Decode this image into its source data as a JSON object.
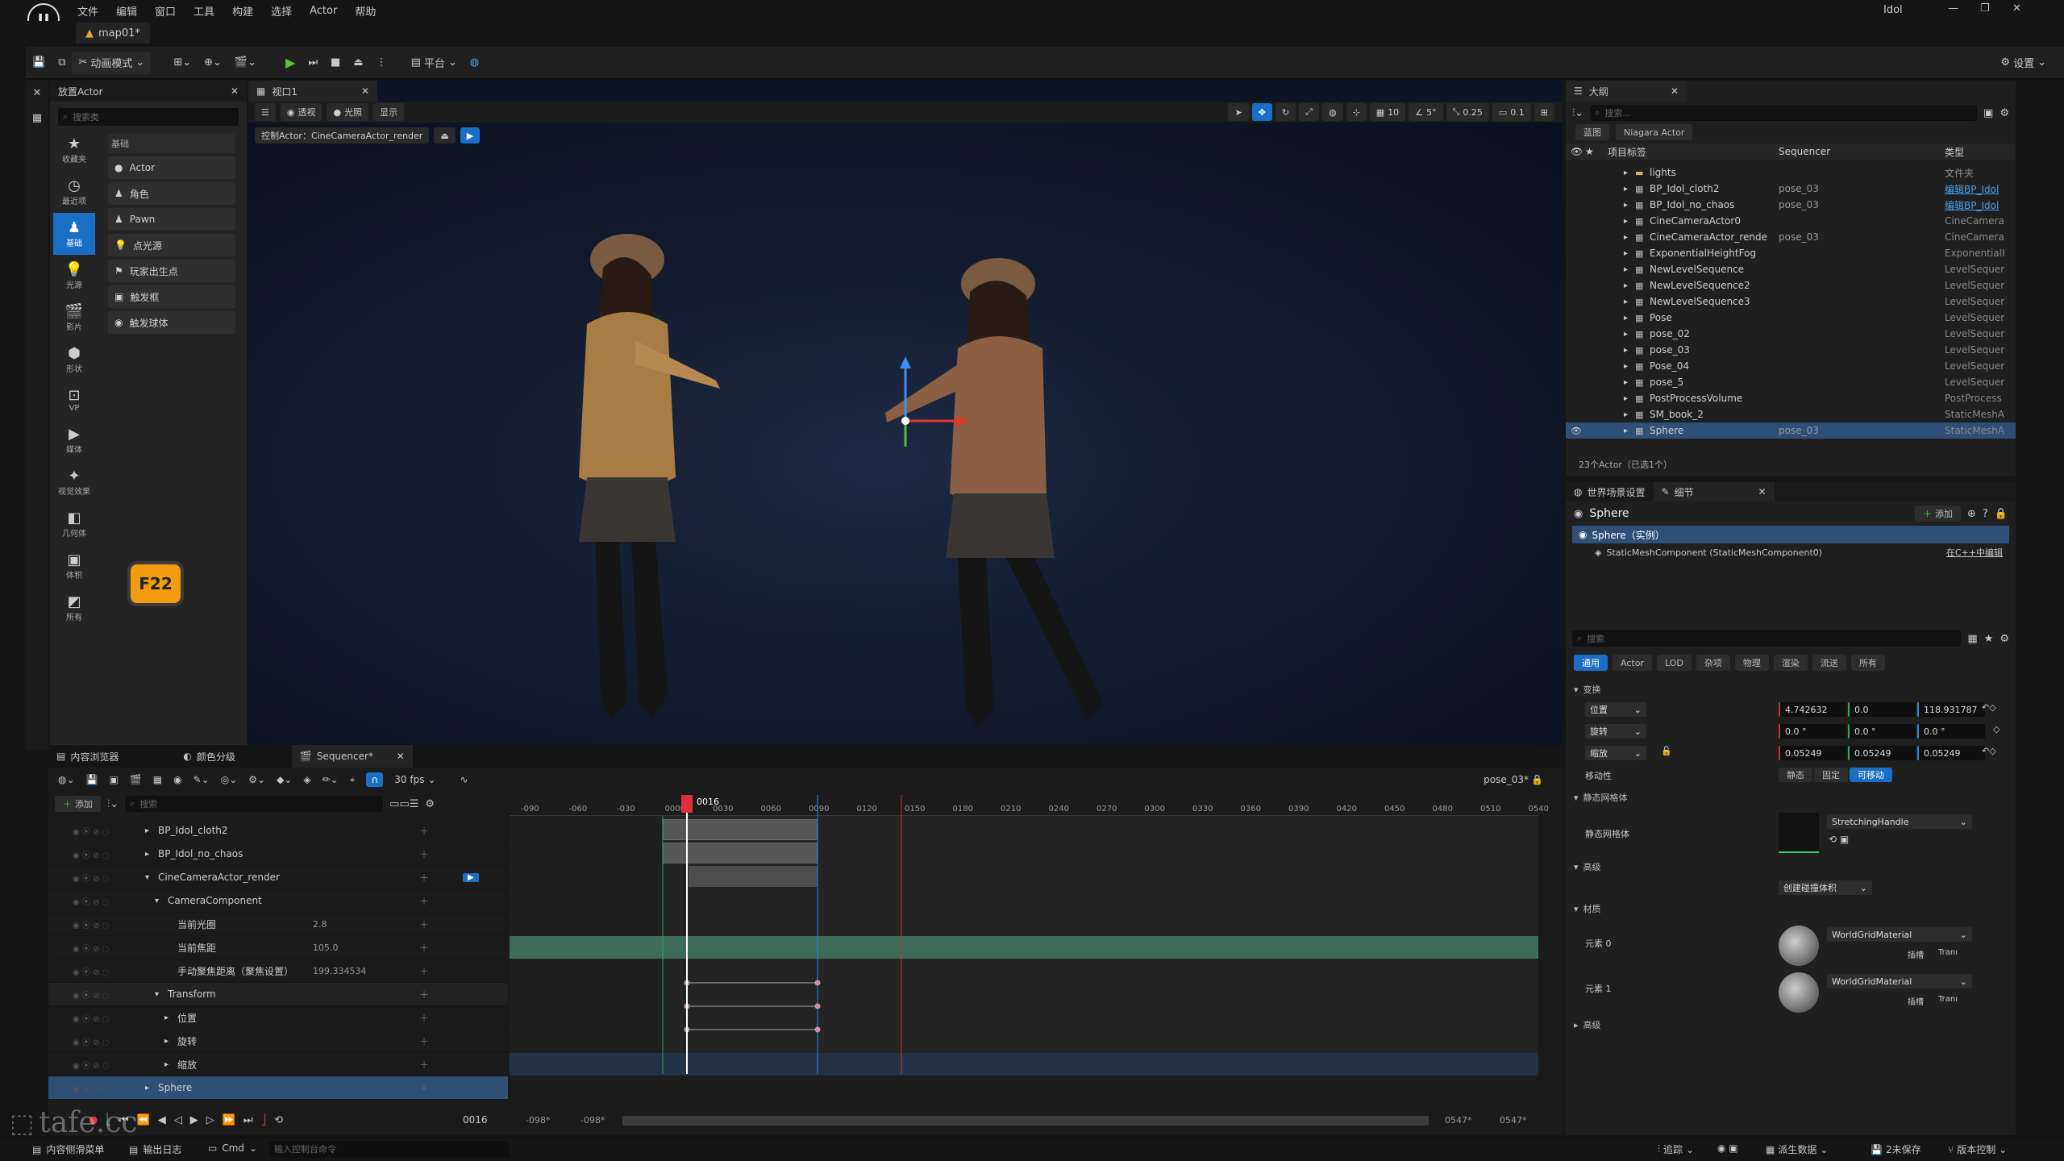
{
  "app": {
    "title": "Idol",
    "map_tab": "map01*",
    "menus": [
      "文件",
      "编辑",
      "窗口",
      "工具",
      "构建",
      "选择",
      "Actor",
      "帮助"
    ],
    "window_controls": [
      "—",
      "❐",
      "✕"
    ]
  },
  "toolbar": {
    "mode_label": "动画模式",
    "platform_label": "平台",
    "settings_label": "设置"
  },
  "left_strip": {
    "labels": [
      "收藏夹",
      "最近项",
      "基础",
      "光源",
      "影片",
      "形状",
      "VP",
      "媒体",
      "视觉效果",
      "几何体",
      "体积",
      "所有"
    ]
  },
  "place_actor": {
    "tab": "放置Actor",
    "search_placeholder": "搜索类",
    "category": "基础",
    "items": [
      "Actor",
      "角色",
      "Pawn",
      "点光源",
      "玩家出生点",
      "触发框",
      "触发球体"
    ]
  },
  "f22_badge": "F22",
  "viewport": {
    "tab": "视口1",
    "buttons": [
      "透视",
      "光照",
      "显示"
    ],
    "pilot_label": "控制Actor：CineCameraActor_render",
    "grid_value": "10",
    "angle_value": "5°",
    "scale_value": "0.25",
    "camera_speed": "0.1"
  },
  "outliner": {
    "tab": "大纲",
    "search_placeholder": "搜索...",
    "filters": [
      "蓝图",
      "Niagara Actor"
    ],
    "col_label": "项目标签",
    "col_seq": "Sequencer",
    "col_type": "类型",
    "rows": [
      {
        "name": "lights",
        "seq": "",
        "type": "文件夹"
      },
      {
        "name": "BP_Idol_cloth2",
        "seq": "pose_03",
        "type": "编辑BP_Idol"
      },
      {
        "name": "BP_Idol_no_chaos",
        "seq": "pose_03",
        "type": "编辑BP_Idol"
      },
      {
        "name": "CineCameraActor0",
        "seq": "",
        "type": "CineCamera"
      },
      {
        "name": "CineCameraActor_rende",
        "seq": "pose_03",
        "type": "CineCamera"
      },
      {
        "name": "ExponentialHeightFog",
        "seq": "",
        "type": "ExponentialH"
      },
      {
        "name": "NewLevelSequence",
        "seq": "",
        "type": "LevelSequer"
      },
      {
        "name": "NewLevelSequence2",
        "seq": "",
        "type": "LevelSequer"
      },
      {
        "name": "NewLevelSequence3",
        "seq": "",
        "type": "LevelSequer"
      },
      {
        "name": "Pose",
        "seq": "",
        "type": "LevelSequer"
      },
      {
        "name": "pose_02",
        "seq": "",
        "type": "LevelSequer"
      },
      {
        "name": "pose_03",
        "seq": "",
        "type": "LevelSequer"
      },
      {
        "name": "Pose_04",
        "seq": "",
        "type": "LevelSequer"
      },
      {
        "name": "pose_5",
        "seq": "",
        "type": "LevelSequer"
      },
      {
        "name": "PostProcessVolume",
        "seq": "",
        "type": "PostProcess"
      },
      {
        "name": "SM_book_2",
        "seq": "",
        "type": "StaticMeshA"
      },
      {
        "name": "Sphere",
        "seq": "pose_03",
        "type": "StaticMeshA"
      }
    ],
    "count_label": "23个Actor（已选1个）"
  },
  "details": {
    "tab_world": "世界场景设置",
    "tab_details": "细节",
    "title": "Sphere",
    "add_label": "添加",
    "instance_label": "Sphere（实例）",
    "component_label": "StaticMeshComponent (StaticMeshComponent0)",
    "cpp_edit": "在C++中编辑",
    "search_placeholder": "搜索",
    "filters": [
      "通用",
      "Actor",
      "LOD",
      "杂项",
      "物理",
      "渲染",
      "流送",
      "所有"
    ],
    "transform_section": "变换",
    "location": {
      "label": "位置",
      "x": "4.742632",
      "y": "0.0",
      "z": "118.931787"
    },
    "rotation": {
      "label": "旋转",
      "x": "0.0 °",
      "y": "0.0 °",
      "z": "0.0 °"
    },
    "scale": {
      "label": "缩放",
      "x": "0.05249",
      "y": "0.05249",
      "z": "0.05249"
    },
    "mobility": {
      "label": "移动性",
      "options": [
        "静态",
        "固定",
        "可移动"
      ]
    },
    "static_mesh_section": "静态网格体",
    "static_mesh_label": "静态网格体",
    "static_mesh_value": "StretchingHandle",
    "advanced": "高级",
    "create_collision": "创建碰撞体积",
    "materials_section": "材质",
    "element0": "元素 0",
    "element1": "元素 1",
    "material_value": "WorldGridMaterial",
    "insert_label": "插槽",
    "tran_label": "Tranı",
    "advanced2": "高级"
  },
  "seq_tabs": [
    "内容浏览器",
    "颜色分级",
    "Sequencer*"
  ],
  "sequencer": {
    "fps": "30 fps",
    "sequence_name": "pose_03*",
    "add_label": "添加",
    "search_placeholder": "搜索",
    "current_frame": "0016",
    "playhead_frame": "0016",
    "ticks": [
      "-090",
      "-060",
      "-030",
      "0000",
      "0030",
      "0060",
      "0090",
      "0120",
      "0150",
      "0180",
      "0210",
      "0240",
      "0270",
      "0300",
      "0330",
      "0360",
      "0390",
      "0420",
      "0450",
      "0480",
      "0510",
      "0540"
    ],
    "start_frame": "-098*",
    "start_frame2": "-098*",
    "end_frame": "0547*",
    "end_frame2": "0547*",
    "tracks": [
      {
        "name": "BP_Idol_cloth2",
        "value": "",
        "indent": 0
      },
      {
        "name": "BP_Idol_no_chaos",
        "value": "",
        "indent": 0
      },
      {
        "name": "CineCameraActor_render",
        "value": "",
        "indent": 0
      },
      {
        "name": "CameraComponent",
        "value": "",
        "indent": 1
      },
      {
        "name": "当前光圈",
        "value": "2.8",
        "indent": 2
      },
      {
        "name": "当前焦距",
        "value": "105.0",
        "indent": 2
      },
      {
        "name": "手动聚焦距离（聚焦设置）",
        "value": "199.334534",
        "indent": 2
      },
      {
        "name": "Transform",
        "value": "",
        "indent": 1
      },
      {
        "name": "位置",
        "value": "",
        "indent": 2
      },
      {
        "name": "旋转",
        "value": "",
        "indent": 2
      },
      {
        "name": "缩放",
        "value": "",
        "indent": 2
      },
      {
        "name": "Sphere",
        "value": "",
        "indent": 0
      }
    ]
  },
  "statusbar": {
    "content_drawer": "内容侧滑菜单",
    "output_log": "输出日志",
    "cmd": "Cmd",
    "console_placeholder": "输入控制台命令",
    "trace": "追踪",
    "derived_data": "派生数据",
    "unsaved": "2未保存",
    "source_control": "版本控制"
  },
  "watermark": "tafe.cc",
  "colors": {
    "accent": "#1a6ec6",
    "selected": "#2e4f76",
    "playhead": "#e03040",
    "badge": "#f39c12"
  }
}
